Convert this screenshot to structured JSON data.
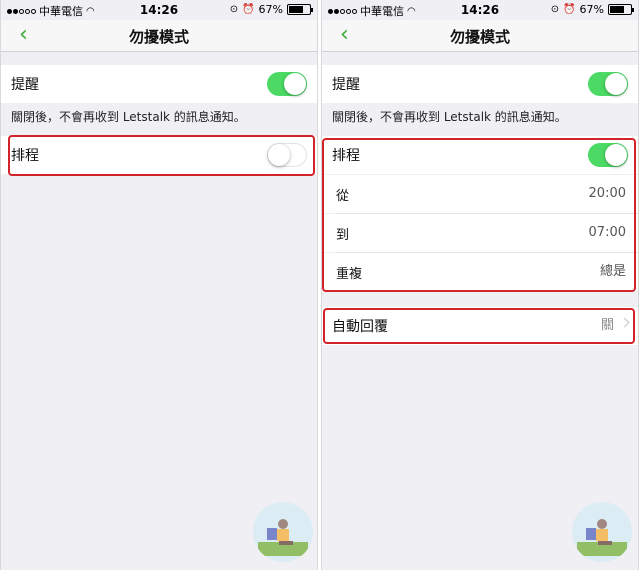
{
  "status": {
    "carrier": "中華電信",
    "time": "14:26",
    "battery": "67%",
    "battery_level": 0.67
  },
  "nav": {
    "back_icon": "chevron-left-icon",
    "title": "勿擾模式"
  },
  "reminder": {
    "label": "提醒",
    "enabled": true
  },
  "note": "關閉後，不會再收到 Letstalk 的訊息通知。",
  "schedule": {
    "label": "排程",
    "left_enabled": false,
    "right_enabled": true,
    "from_label": "從",
    "from_value": "20:00",
    "to_label": "到",
    "to_value": "07:00",
    "repeat_label": "重複",
    "repeat_value": "總是"
  },
  "auto_reply": {
    "label": "自動回覆",
    "value": "關"
  },
  "colors": {
    "accent": "#4cd964",
    "back": "#3aa935",
    "highlight": "#d2232a",
    "background": "#efeff4"
  }
}
